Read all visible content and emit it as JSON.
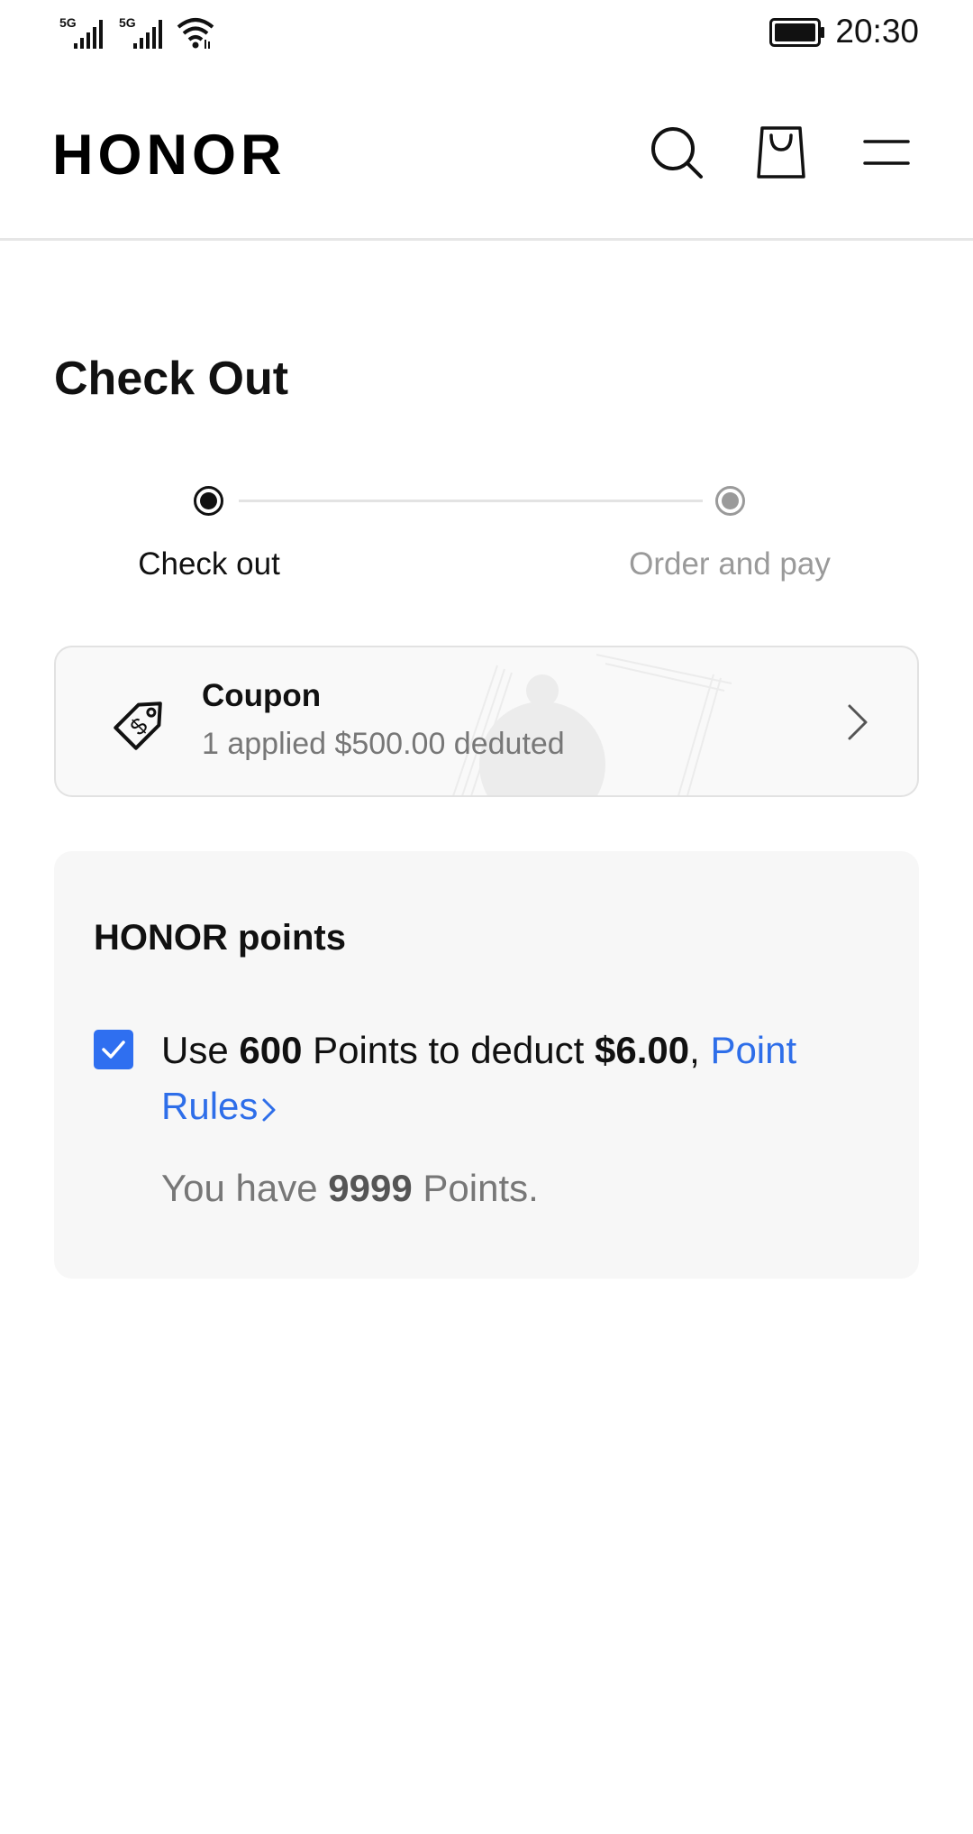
{
  "status_bar": {
    "signal_1_label": "5G",
    "signal_2_label": "5G",
    "time": "20:30",
    "icons": [
      "signal-icon",
      "signal-icon",
      "wifi-icon",
      "battery-icon"
    ]
  },
  "header": {
    "logo": "HONOR",
    "icons": [
      "search-icon",
      "shopping-bag-icon",
      "menu-icon"
    ]
  },
  "page": {
    "title": "Check Out"
  },
  "stepper": {
    "steps": [
      {
        "label": "Check out",
        "state": "active"
      },
      {
        "label": "Order and pay",
        "state": "inactive"
      }
    ]
  },
  "coupon": {
    "title": "Coupon",
    "subtitle": "1 applied $500.00 deduted",
    "icon": "price-tag-icon"
  },
  "points": {
    "title": "HONOR points",
    "checked": true,
    "use_prefix": "Use ",
    "points_used": "600",
    "mid_text": " Points to deduct ",
    "deduct_amount": "$6.00",
    "comma": ", ",
    "rules_link": "Point Rules",
    "balance_prefix": "You have ",
    "balance": "9999",
    "balance_suffix": " Points."
  },
  "colors": {
    "accent": "#2f6ff0",
    "link": "#2e6ee9",
    "muted_text": "#777777",
    "card_bg": "#f7f7f7"
  }
}
